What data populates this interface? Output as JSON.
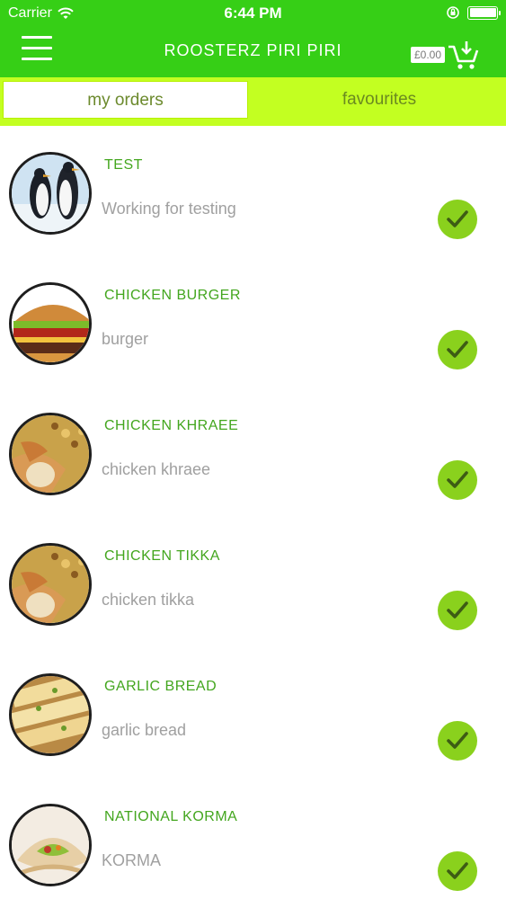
{
  "status_bar": {
    "carrier": "Carrier",
    "time": "6:44 PM",
    "icons": [
      "wifi-icon",
      "orientation-lock-icon",
      "battery-icon"
    ]
  },
  "header": {
    "title": "ROOSTERZ PIRI PIRI",
    "cart_price": "£0.00",
    "menu_icon": "hamburger-icon",
    "cart_icon": "cart-download-icon",
    "accent_color": "#36cf16"
  },
  "tabs": [
    {
      "label": "my orders",
      "active": true
    },
    {
      "label": "favourites",
      "active": false
    }
  ],
  "items": [
    {
      "name": "TEST",
      "description": "Working for testing",
      "image": "penguins",
      "checked": true
    },
    {
      "name": "CHICKEN BURGER",
      "description": "burger",
      "image": "burger",
      "checked": true
    },
    {
      "name": "CHICKEN KHRAEE",
      "description": "chicken khraee",
      "image": "chicken-rice",
      "checked": true
    },
    {
      "name": "CHICKEN TIKKA",
      "description": "chicken tikka",
      "image": "chicken-rice",
      "checked": true
    },
    {
      "name": "GARLIC BREAD",
      "description": "garlic bread",
      "image": "garlic-bread",
      "checked": true
    },
    {
      "name": "NATIONAL KORMA",
      "description": "KORMA",
      "image": "wrap",
      "checked": true
    }
  ]
}
